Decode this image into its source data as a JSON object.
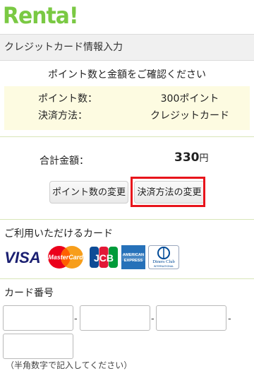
{
  "logo": {
    "text": "Renta!"
  },
  "header": {
    "title": "クレジットカード情報入力"
  },
  "confirm": {
    "title": "ポイント数と金額をご確認ください",
    "points_label": "ポイント数：",
    "points_value": "300ポイント",
    "method_label": "決済方法：",
    "method_value": "クレジットカード"
  },
  "total": {
    "label": "合計金額：",
    "amount": "330",
    "unit": "円"
  },
  "buttons": {
    "change_points": "ポイント数の変更",
    "change_method": "決済方法の変更"
  },
  "cards": {
    "title": "ご利用いただけるカード",
    "visa": "VISA",
    "mastercard": "MasterCard",
    "jcb": "JCB",
    "amex_top": "AMERICAN",
    "amex_bottom": "EXPRESS",
    "diners_top": "Diners Club",
    "diners_bottom": "INTERNATIONAL"
  },
  "card_number": {
    "title": "カード番号",
    "note": "（半角数字で記入してください）"
  },
  "colors": {
    "brand_green": "#7ac943",
    "highlight_red": "#e8141b",
    "info_bg": "#fdfbe1"
  }
}
